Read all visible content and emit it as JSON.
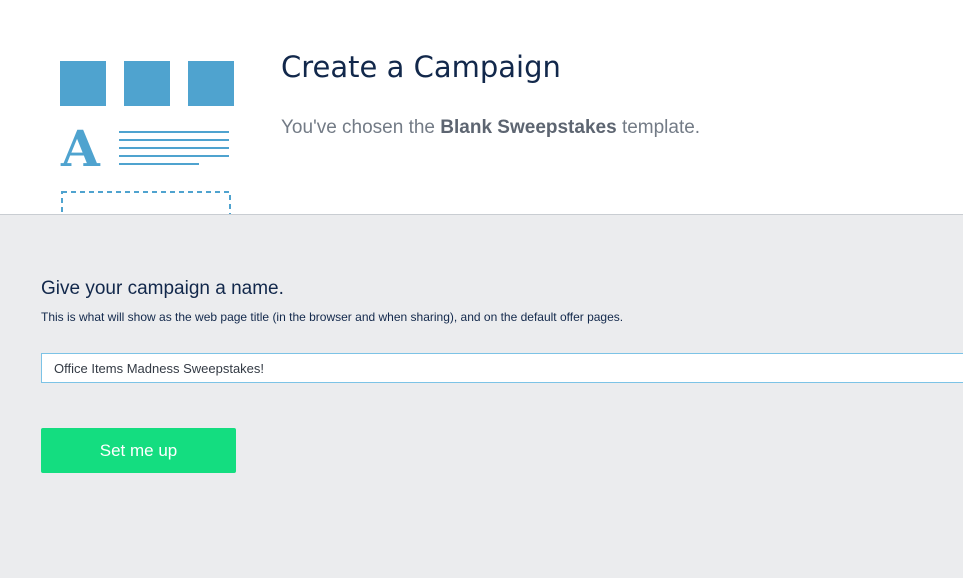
{
  "header": {
    "title": "Create a Campaign",
    "subtitle_prefix": "You've chosen the",
    "template_name": "Blank Sweepstakes",
    "subtitle_suffix": "template."
  },
  "illustration": {
    "icon": "template-layout-icon",
    "letter": "A",
    "color": "#4fa3cf"
  },
  "form": {
    "heading": "Give your campaign a name.",
    "helper_text": "This is what will show as the web page title (in the browser and when sharing), and on the default offer pages.",
    "name_value": "Office Items Madness Sweepstakes!",
    "submit_label": "Set me up"
  },
  "colors": {
    "title": "#12284b",
    "accent_button": "#14dd80",
    "input_border": "#7cc3e6",
    "panel_background": "#ebecee"
  }
}
